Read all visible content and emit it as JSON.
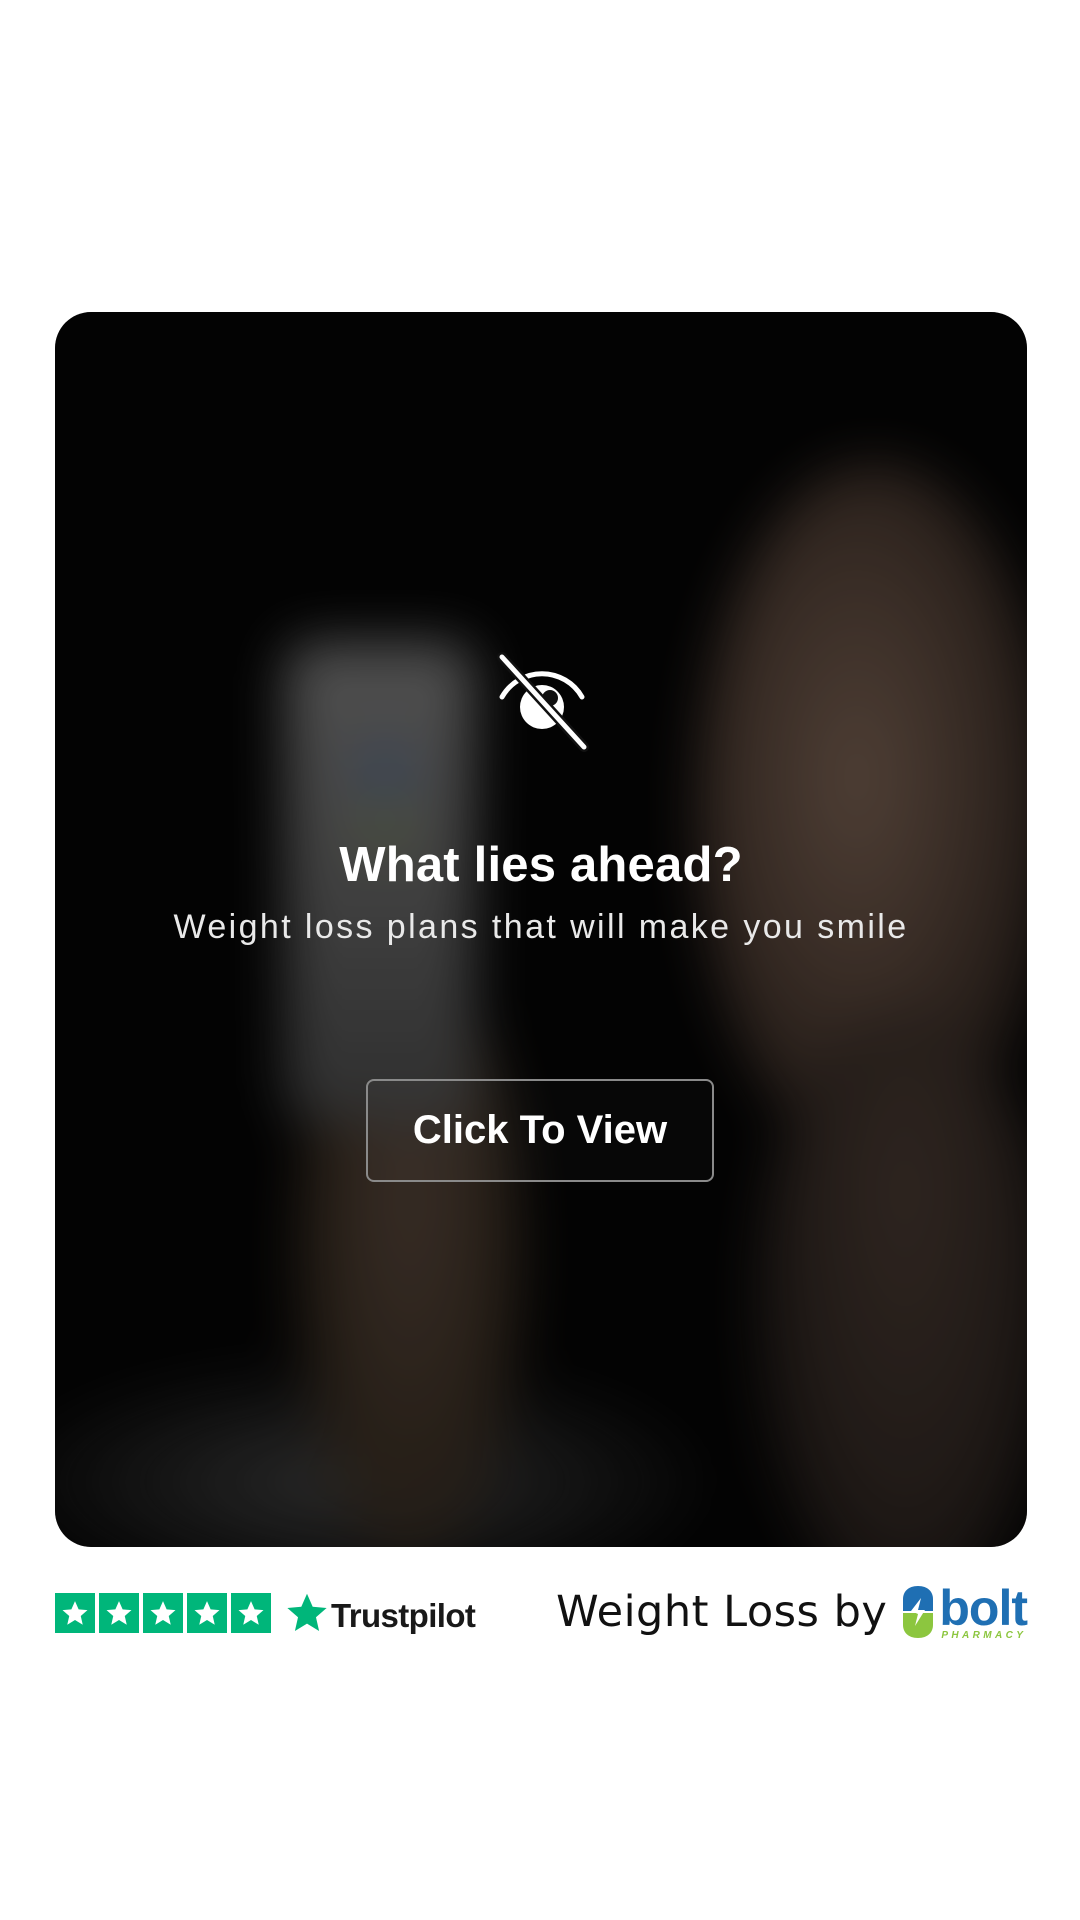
{
  "card": {
    "title": "What lies ahead?",
    "subtitle": "Weight loss plans that will make you smile",
    "button_label": "Click To View",
    "icon": "eye-slash-icon"
  },
  "footer": {
    "trustpilot": {
      "rating_stars": 5,
      "wordmark": "Trustpilot",
      "color": "#00b67a"
    },
    "brand": {
      "prefix": "Weight Loss by",
      "logo_word": "bolt",
      "logo_sub": "PHARMACY",
      "primary_color": "#1f6fb3",
      "accent_color": "#8cc63f"
    }
  }
}
